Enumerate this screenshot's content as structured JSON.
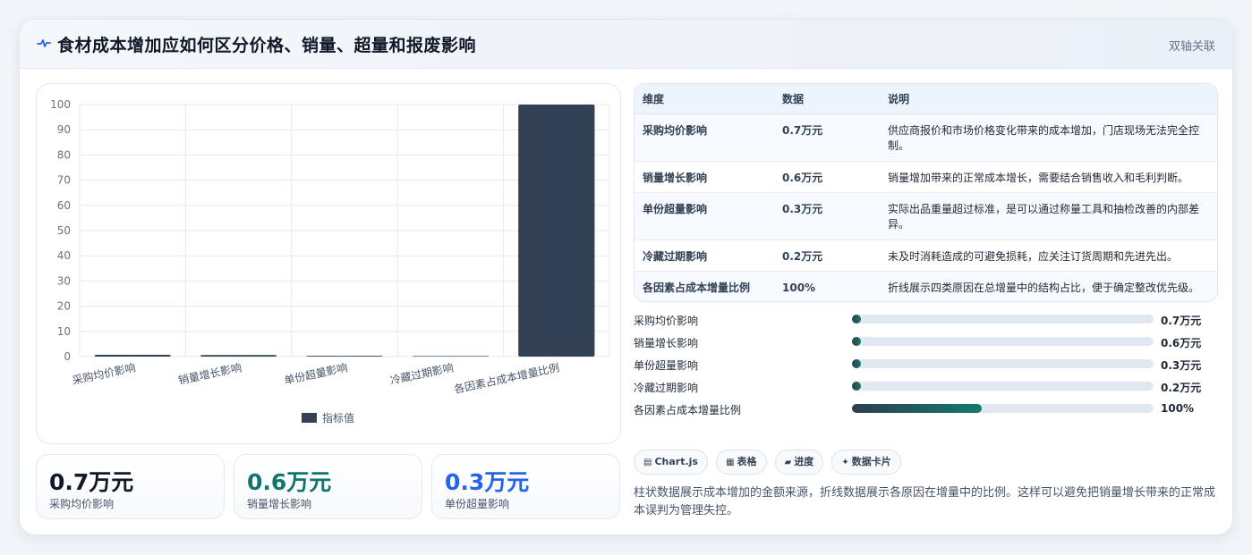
{
  "header": {
    "title": "食材成本增加应如何区分价格、销量、超量和报废影响",
    "right_label": "双轴关联",
    "icon": "pulse-icon"
  },
  "chart_data": {
    "type": "bar",
    "categories": [
      "采购均价影响",
      "销量增长影响",
      "单份超量影响",
      "冷藏过期影响",
      "各因素占成本增量比例"
    ],
    "series": [
      {
        "name": "指标值",
        "values": [
          0.7,
          0.6,
          0.3,
          0.2,
          100
        ]
      }
    ],
    "ylim": [
      0,
      100
    ],
    "yticks": [
      0,
      10,
      20,
      30,
      40,
      50,
      60,
      70,
      80,
      90,
      100
    ],
    "grid": true,
    "legend": "bottom",
    "colors": {
      "bar": "#334155"
    }
  },
  "kpis": [
    {
      "value": "0.7万元",
      "label": "采购均价影响",
      "color": "#111827"
    },
    {
      "value": "0.6万元",
      "label": "销量增长影响",
      "color": "#0f766e"
    },
    {
      "value": "0.3万元",
      "label": "单份超量影响",
      "color": "#2563eb"
    }
  ],
  "table": {
    "headers": [
      "维度",
      "数据",
      "说明"
    ],
    "rows": [
      {
        "dim": "采购均价影响",
        "val": "0.7万元",
        "desc": "供应商报价和市场价格变化带来的成本增加，门店现场无法完全控制。"
      },
      {
        "dim": "销量增长影响",
        "val": "0.6万元",
        "desc": "销量增加带来的正常成本增长，需要结合销售收入和毛利判断。"
      },
      {
        "dim": "单份超量影响",
        "val": "0.3万元",
        "desc": "实际出品重量超过标准，是可以通过称量工具和抽检改善的内部差异。"
      },
      {
        "dim": "冷藏过期影响",
        "val": "0.2万元",
        "desc": "未及时消耗造成的可避免损耗，应关注订货周期和先进先出。"
      },
      {
        "dim": "各因素占成本增量比例",
        "val": "100%",
        "desc": "折线展示四类原因在总增量中的结构占比，便于确定整改优先级。"
      }
    ]
  },
  "progress": [
    {
      "label": "采购均价影响",
      "value": "0.7万元",
      "fraction": 0.007
    },
    {
      "label": "销量增长影响",
      "value": "0.6万元",
      "fraction": 0.006
    },
    {
      "label": "单份超量影响",
      "value": "0.3万元",
      "fraction": 0.003
    },
    {
      "label": "冷藏过期影响",
      "value": "0.2万元",
      "fraction": 0.002
    },
    {
      "label": "各因素占成本增量比例",
      "value": "100%",
      "fraction": 0.43
    }
  ],
  "tags": [
    {
      "icon": "▤",
      "label": "Chart.js"
    },
    {
      "icon": "▦",
      "label": "表格"
    },
    {
      "icon": "▰",
      "label": "进度"
    },
    {
      "icon": "✦",
      "label": "数据卡片"
    }
  ],
  "note": "柱状数据展示成本增加的金额来源，折线数据展示各原因在增量中的比例。这样可以避免把销量增长带来的正常成本误判为管理失控。"
}
